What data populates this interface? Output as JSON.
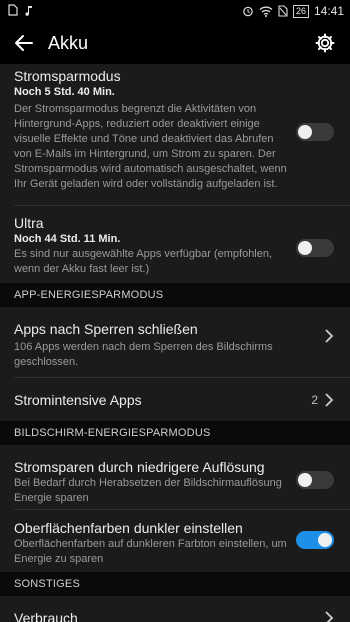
{
  "statusbar": {
    "time": "14:41",
    "battery": "26"
  },
  "header": {
    "title": "Akku"
  },
  "power_saving": {
    "title": "Stromsparmodus",
    "subtitle": "Noch 5 Std. 40 Min.",
    "description": "Der Stromsparmodus begrenzt die Aktivitäten von Hintergrund-Apps, reduziert oder deaktiviert einige visuelle Effekte und Töne und deaktiviert das Abrufen von E-Mails im Hintergrund, um Strom zu sparen. Der Stromsparmodus wird automatisch ausgeschaltet, wenn Ihr Gerät geladen wird oder vollständig aufgeladen ist.",
    "enabled": false
  },
  "ultra": {
    "title": "Ultra",
    "subtitle": "Noch 44 Std. 11 Min.",
    "description": "Es sind nur ausgewählte Apps verfügbar (empfohlen, wenn der Akku fast leer ist.)",
    "enabled": false
  },
  "section_app": {
    "label": "APP-ENERGIESPARMODUS"
  },
  "close_apps": {
    "title": "Apps nach Sperren schließen",
    "description": "106 Apps werden nach dem Sperren des Bildschirms geschlossen."
  },
  "intensive_apps": {
    "title": "Stromintensive Apps",
    "count": "2"
  },
  "section_screen": {
    "label": "BILDSCHIRM-ENERGIESPARMODUS"
  },
  "low_resolution": {
    "title": "Stromsparen durch niedrigere Auflösung",
    "description": "Bei Bedarf durch Herabsetzen der Bildschirmauflösung Energie sparen",
    "enabled": false
  },
  "dark_colors": {
    "title": "Oberflächenfarben dunkler einstellen",
    "description": "Oberflächenfarben auf dunkleren Farbton einstellen, um Energie zu sparen",
    "enabled": true
  },
  "section_other": {
    "label": "SONSTIGES"
  },
  "usage": {
    "title": "Verbrauch"
  },
  "colors": {
    "accent": "#1e8fe6",
    "background": "#1b1b1b"
  }
}
